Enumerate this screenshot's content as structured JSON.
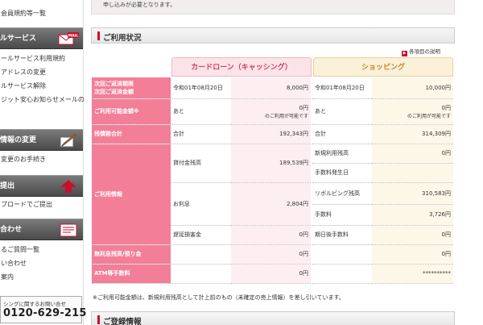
{
  "sidebar": {
    "link_top": "会員規約等一覧",
    "sections": [
      {
        "title": "ルサービス",
        "badge": "MAIL",
        "links": [
          "ールサービス利用規約",
          "アドレスの変更",
          "ルサービス解除",
          "ジット安心お知らせメールの"
        ]
      },
      {
        "title": "情報の変更",
        "links": [
          "変更のお手続き"
        ]
      },
      {
        "title": "提出",
        "links": [
          "プロードでご提出"
        ]
      },
      {
        "title": "合わせ",
        "links": [
          "るご質問一覧",
          "い合わせ",
          "案内"
        ]
      }
    ],
    "contact_label": "シングに関するお問い合せ",
    "contact_tel": "0120-629-215"
  },
  "main": {
    "top_note": "申し込みが必要となります。",
    "usage_title": "ご利用状況",
    "explain_link": "各項目の説明",
    "loan_header": "カードローン（キャッシング）",
    "shop_header": "ショッピング",
    "rows": {
      "due": {
        "label": "次回ご返済期限\n次回ご返済金額",
        "loan_date": "令和01年08月20日",
        "loan_amount": "8,000円",
        "shop_date": "令和01年08月20日",
        "shop_amount": "10,000円"
      },
      "available": {
        "label": "ご利用可能金額※",
        "loan_label": "あと",
        "loan_amount": "0円",
        "loan_sub": "のご利用が可能です",
        "shop_label": "あと",
        "shop_amount": "0円",
        "shop_sub": "のご利用が可能です"
      },
      "balance": {
        "label": "残債務合計",
        "loan_label": "合計",
        "loan_value": "192,343円",
        "shop_label": "合計",
        "shop_value": "314,309円"
      },
      "info": {
        "label": "ご利用情報",
        "loan_principal_label": "貸付金残高",
        "loan_principal": "189,539円",
        "loan_interest_label": "お利息",
        "loan_interest": "2,804円",
        "loan_late_label": "遅延損害金",
        "loan_late": "0円",
        "shop_new_label": "新規利用残高",
        "shop_new": "0円",
        "shop_fee_occ_label": "手数料発生日",
        "shop_fee_occ": "",
        "shop_revolving_label": "リボルビング残高",
        "shop_revolving": "310,583円",
        "shop_fee_label": "手数料",
        "shop_fee": "3,726円",
        "shop_overdue_label": "期日後手数料",
        "shop_overdue": "0円"
      },
      "interest_free": {
        "label": "無利息残高/預り金",
        "loan_value": "0円",
        "shop_value": "0円"
      },
      "atm": {
        "label": "ATM等手数料",
        "loan_value": "0円",
        "shop_value": "**********"
      }
    },
    "footnote": "※ご利用可能金額は、新規利用残高として計上前のもの（未確定の売上情報）を差し引いています。",
    "reg_title": "ご登録情報"
  }
}
